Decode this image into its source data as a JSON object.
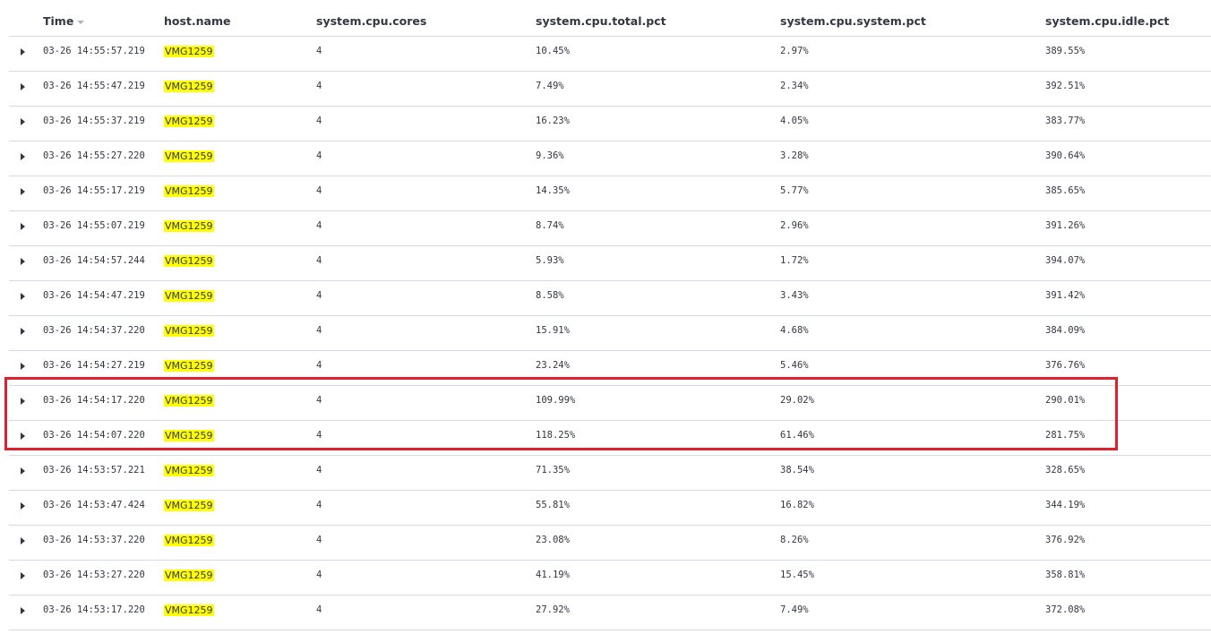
{
  "columns": {
    "time": "Time",
    "host": "host.name",
    "cores": "system.cpu.cores",
    "total": "system.cpu.total.pct",
    "system": "system.cpu.system.pct",
    "idle": "system.cpu.idle.pct"
  },
  "rows": [
    {
      "time": "03-26 14:55:57.219",
      "host": "VMG1259",
      "cores": "4",
      "total": "10.45%",
      "system": "2.97%",
      "idle": "389.55%"
    },
    {
      "time": "03-26 14:55:47.219",
      "host": "VMG1259",
      "cores": "4",
      "total": "7.49%",
      "system": "2.34%",
      "idle": "392.51%"
    },
    {
      "time": "03-26 14:55:37.219",
      "host": "VMG1259",
      "cores": "4",
      "total": "16.23%",
      "system": "4.05%",
      "idle": "383.77%"
    },
    {
      "time": "03-26 14:55:27.220",
      "host": "VMG1259",
      "cores": "4",
      "total": "9.36%",
      "system": "3.28%",
      "idle": "390.64%"
    },
    {
      "time": "03-26 14:55:17.219",
      "host": "VMG1259",
      "cores": "4",
      "total": "14.35%",
      "system": "5.77%",
      "idle": "385.65%"
    },
    {
      "time": "03-26 14:55:07.219",
      "host": "VMG1259",
      "cores": "4",
      "total": "8.74%",
      "system": "2.96%",
      "idle": "391.26%"
    },
    {
      "time": "03-26 14:54:57.244",
      "host": "VMG1259",
      "cores": "4",
      "total": "5.93%",
      "system": "1.72%",
      "idle": "394.07%"
    },
    {
      "time": "03-26 14:54:47.219",
      "host": "VMG1259",
      "cores": "4",
      "total": "8.58%",
      "system": "3.43%",
      "idle": "391.42%"
    },
    {
      "time": "03-26 14:54:37.220",
      "host": "VMG1259",
      "cores": "4",
      "total": "15.91%",
      "system": "4.68%",
      "idle": "384.09%"
    },
    {
      "time": "03-26 14:54:27.219",
      "host": "VMG1259",
      "cores": "4",
      "total": "23.24%",
      "system": "5.46%",
      "idle": "376.76%"
    },
    {
      "time": "03-26 14:54:17.220",
      "host": "VMG1259",
      "cores": "4",
      "total": "109.99%",
      "system": "29.02%",
      "idle": "290.01%"
    },
    {
      "time": "03-26 14:54:07.220",
      "host": "VMG1259",
      "cores": "4",
      "total": "118.25%",
      "system": "61.46%",
      "idle": "281.75%"
    },
    {
      "time": "03-26 14:53:57.221",
      "host": "VMG1259",
      "cores": "4",
      "total": "71.35%",
      "system": "38.54%",
      "idle": "328.65%"
    },
    {
      "time": "03-26 14:53:47.424",
      "host": "VMG1259",
      "cores": "4",
      "total": "55.81%",
      "system": "16.82%",
      "idle": "344.19%"
    },
    {
      "time": "03-26 14:53:37.220",
      "host": "VMG1259",
      "cores": "4",
      "total": "23.08%",
      "system": "8.26%",
      "idle": "376.92%"
    },
    {
      "time": "03-26 14:53:27.220",
      "host": "VMG1259",
      "cores": "4",
      "total": "41.19%",
      "system": "15.45%",
      "idle": "358.81%"
    },
    {
      "time": "03-26 14:53:17.220",
      "host": "VMG1259",
      "cores": "4",
      "total": "27.92%",
      "system": "7.49%",
      "idle": "372.08%"
    }
  ],
  "colors": {
    "highlight_box": "#e0202a",
    "host_highlight": "#ffff00",
    "row_border": "#d3dae6"
  },
  "sort": {
    "column": "time",
    "direction": "descending"
  }
}
